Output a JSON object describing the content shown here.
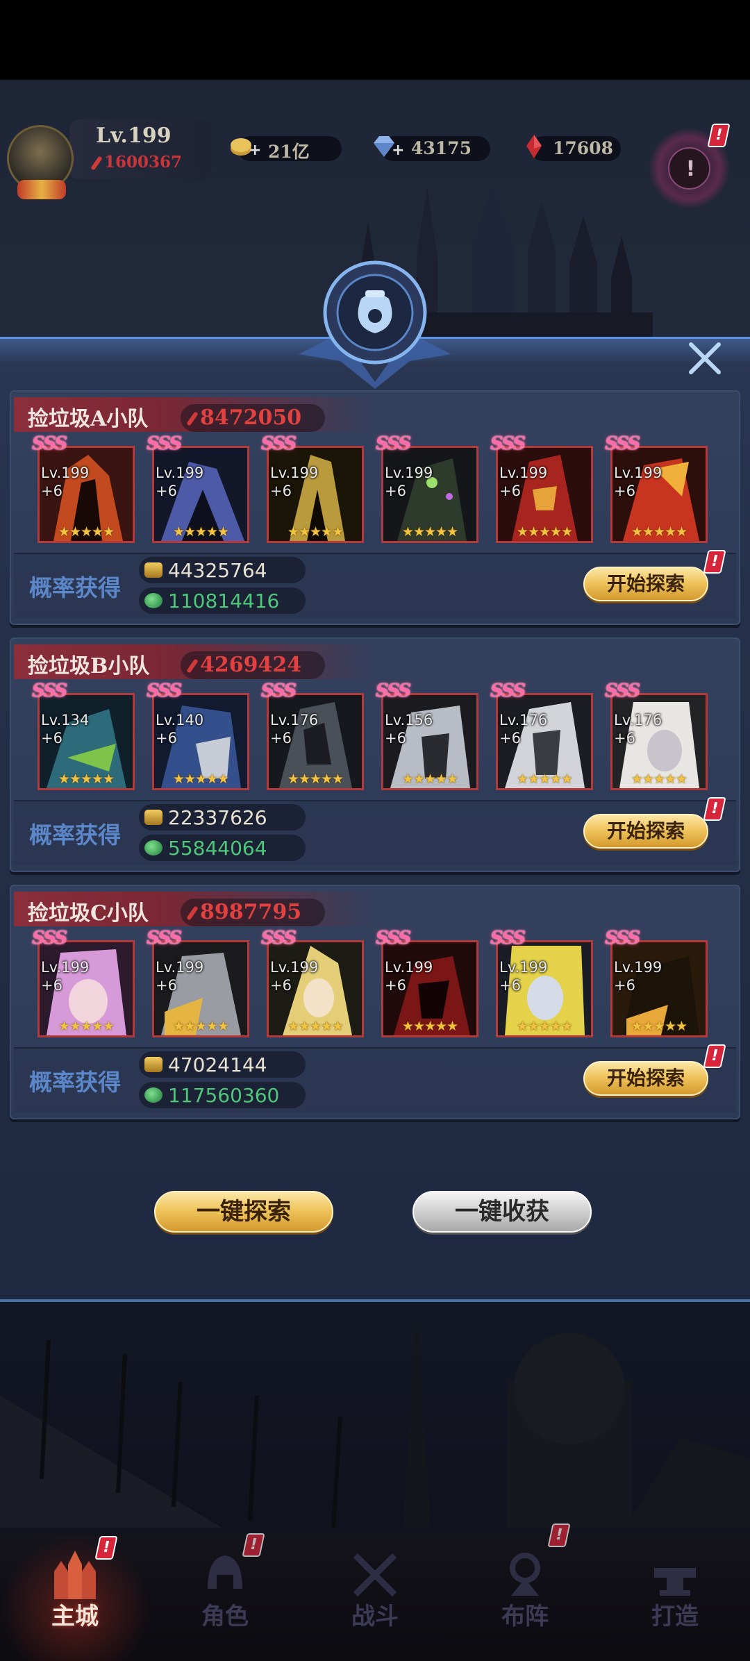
{
  "player": {
    "level": "Lv.199",
    "power": "1600367"
  },
  "resources": [
    {
      "icon": "gold-coin-icon",
      "value": "21亿"
    },
    {
      "icon": "diamond-icon",
      "value": "43175"
    },
    {
      "icon": "red-gem-icon",
      "value": "17608"
    }
  ],
  "teams": [
    {
      "name": "捡垃圾A小队",
      "power": "8472050",
      "prob_label": "概率获得",
      "gold": "44325764",
      "potion": "110814416",
      "explore_label": "开始探索",
      "heroes": [
        {
          "rank": "SSS",
          "level": "Lv.199",
          "plus": "+6",
          "stars": 5
        },
        {
          "rank": "SSS",
          "level": "Lv.199",
          "plus": "+6",
          "stars": 5
        },
        {
          "rank": "SSS",
          "level": "Lv.199",
          "plus": "+6",
          "stars": 5
        },
        {
          "rank": "SSS",
          "level": "Lv.199",
          "plus": "+6",
          "stars": 5
        },
        {
          "rank": "SSS",
          "level": "Lv.199",
          "plus": "+6",
          "stars": 5
        },
        {
          "rank": "SSS",
          "level": "Lv.199",
          "plus": "+6",
          "stars": 5
        }
      ]
    },
    {
      "name": "捡垃圾B小队",
      "power": "4269424",
      "prob_label": "概率获得",
      "gold": "22337626",
      "potion": "55844064",
      "explore_label": "开始探索",
      "heroes": [
        {
          "rank": "SSS",
          "level": "Lv.134",
          "plus": "+6",
          "stars": 5
        },
        {
          "rank": "SSS",
          "level": "Lv.140",
          "plus": "+6",
          "stars": 5
        },
        {
          "rank": "SSS",
          "level": "Lv.176",
          "plus": "+6",
          "stars": 5
        },
        {
          "rank": "SSS",
          "level": "Lv.156",
          "plus": "+6",
          "stars": 5
        },
        {
          "rank": "SSS",
          "level": "Lv.176",
          "plus": "+6",
          "stars": 5
        },
        {
          "rank": "SSS",
          "level": "Lv.176",
          "plus": "+6",
          "stars": 5
        }
      ]
    },
    {
      "name": "捡垃圾C小队",
      "power": "8987795",
      "prob_label": "概率获得",
      "gold": "47024144",
      "potion": "117560360",
      "explore_label": "开始探索",
      "heroes": [
        {
          "rank": "SSS",
          "level": "Lv.199",
          "plus": "+6",
          "stars": 5
        },
        {
          "rank": "SSS",
          "level": "Lv.199",
          "plus": "+6",
          "stars": 5
        },
        {
          "rank": "SSS",
          "level": "Lv.199",
          "plus": "+6",
          "stars": 5
        },
        {
          "rank": "SSS",
          "level": "Lv.199",
          "plus": "+6",
          "stars": 5
        },
        {
          "rank": "SSS",
          "level": "Lv.199",
          "plus": "+6",
          "stars": 5
        },
        {
          "rank": "SSS",
          "level": "Lv.199",
          "plus": "+6",
          "stars": 5
        }
      ]
    }
  ],
  "actions": {
    "explore_all": "一键探索",
    "collect_all": "一键收获"
  },
  "nav": [
    {
      "label": "主城",
      "icon": "castle-icon",
      "active": true,
      "badge": true
    },
    {
      "label": "角色",
      "icon": "helmet-icon",
      "active": false,
      "badge": true
    },
    {
      "label": "战斗",
      "icon": "crossed-swords-icon",
      "active": false,
      "badge": false
    },
    {
      "label": "布阵",
      "icon": "formation-icon",
      "active": false,
      "badge": true
    },
    {
      "label": "打造",
      "icon": "anvil-icon",
      "active": false,
      "badge": false
    }
  ],
  "colors": {
    "power_red": "#e2413f",
    "team_header": "#8a2e3a",
    "probability_blue": "#5b86c8",
    "potion_green": "#4fc77a",
    "button_gold": "#f0c55e",
    "hero_frame": "#b33a3a",
    "star_gold": "#f2c241"
  }
}
